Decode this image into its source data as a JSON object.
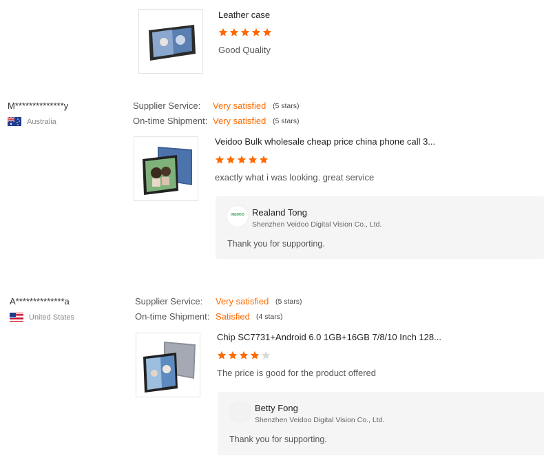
{
  "colors": {
    "accent": "#ff6a00",
    "star_on": "#ff6a00",
    "star_off": "#d9d9d9"
  },
  "reviews": [
    {
      "product_title": "Leather case",
      "rating": 5,
      "comment": "Good Quality"
    },
    {
      "buyer": "M**************y",
      "country": "Australia",
      "flag_icon": "australia-flag-icon",
      "supplier_label": "Supplier Service:",
      "supplier_value": "Very satisfied",
      "supplier_note": "(5 stars)",
      "shipment_label": "On-time Shipment:",
      "shipment_value": "Very satisfied",
      "shipment_note": "(5 stars)",
      "product_title": "Veidoo Bulk wholesale cheap price china phone call 3...",
      "rating": 5,
      "comment": "exactly what i was looking. great service",
      "reply": {
        "name": "Realand Tong",
        "company": "Shenzhen Veidoo Digital Vision Co., Ltd.",
        "text": "Thank you for supporting.",
        "logo_text": "VEIDOO"
      }
    },
    {
      "buyer": "A**************a",
      "country": "United States",
      "flag_icon": "usa-flag-icon",
      "supplier_label": "Supplier Service:",
      "supplier_value": "Very satisfied",
      "supplier_note": "(5 stars)",
      "shipment_label": "On-time Shipment:",
      "shipment_value": "Satisfied",
      "shipment_note": "(4 stars)",
      "product_title": "Chip SC7731+Android 6.0 1GB+16GB 7/8/10 Inch 128...",
      "rating": 4,
      "comment": "The price is good for the product offered",
      "reply": {
        "name": "Betty Fong",
        "company": "Shenzhen Veidoo Digital Vision Co., Ltd.",
        "text": "Thank you for supporting."
      }
    }
  ]
}
